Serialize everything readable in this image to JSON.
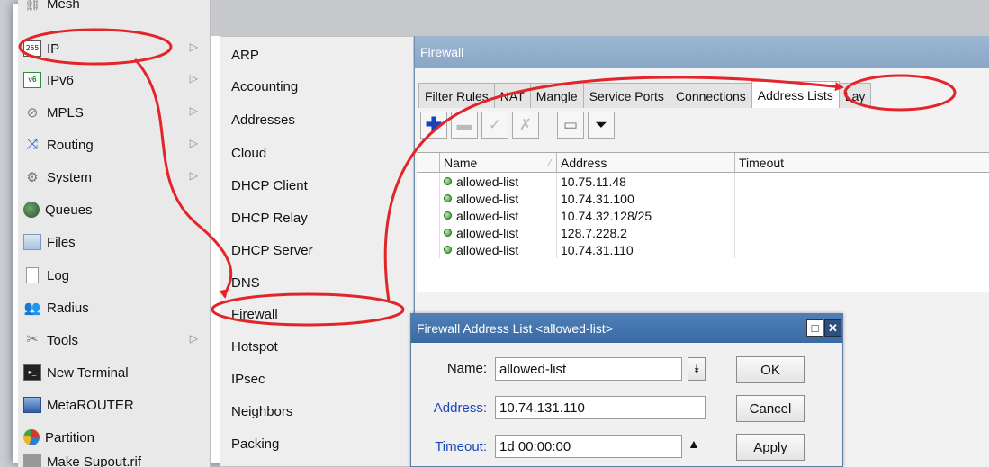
{
  "left_menu": {
    "items": [
      {
        "label": "Mesh",
        "icon": "mesh-icon"
      },
      {
        "label": "IP",
        "icon": "ip-icon",
        "icon_text": "255",
        "has_submenu": true
      },
      {
        "label": "IPv6",
        "icon": "ipv6-icon",
        "icon_text": "v6",
        "has_submenu": true
      },
      {
        "label": "MPLS",
        "icon": "mpls-icon",
        "has_submenu": true
      },
      {
        "label": "Routing",
        "icon": "routing-icon",
        "has_submenu": true
      },
      {
        "label": "System",
        "icon": "system-icon",
        "has_submenu": true
      },
      {
        "label": "Queues",
        "icon": "queues-icon"
      },
      {
        "label": "Files",
        "icon": "files-icon"
      },
      {
        "label": "Log",
        "icon": "log-icon"
      },
      {
        "label": "Radius",
        "icon": "radius-icon"
      },
      {
        "label": "Tools",
        "icon": "tools-icon",
        "has_submenu": true
      },
      {
        "label": "New Terminal",
        "icon": "terminal-icon"
      },
      {
        "label": "MetaROUTER",
        "icon": "metarouter-icon"
      },
      {
        "label": "Partition",
        "icon": "partition-icon"
      },
      {
        "label": "Make Supout.rif",
        "icon": "supout-icon"
      }
    ]
  },
  "ip_submenu": {
    "items": [
      "ARP",
      "Accounting",
      "Addresses",
      "Cloud",
      "DHCP Client",
      "DHCP Relay",
      "DHCP Server",
      "DNS",
      "Firewall",
      "Hotspot",
      "IPsec",
      "Neighbors",
      "Packing"
    ]
  },
  "firewall": {
    "title": "Firewall",
    "tabs": [
      "Filter Rules",
      "NAT",
      "Mangle",
      "Service Ports",
      "Connections",
      "Address Lists",
      "Lay"
    ],
    "active_tab": "Address Lists",
    "columns": [
      "Name",
      "Address",
      "Timeout"
    ],
    "rows": [
      {
        "name": "allowed-list",
        "address": "10.75.11.48",
        "timeout": ""
      },
      {
        "name": "allowed-list",
        "address": "10.74.31.100",
        "timeout": ""
      },
      {
        "name": "allowed-list",
        "address": "10.74.32.128/25",
        "timeout": ""
      },
      {
        "name": "allowed-list",
        "address": "128.7.228.2",
        "timeout": ""
      },
      {
        "name": "allowed-list",
        "address": "10.74.31.110",
        "timeout": ""
      }
    ]
  },
  "dialog": {
    "title": "Firewall Address List <allowed-list>",
    "name_label": "Name:",
    "name_value": "allowed-list",
    "address_label": "Address:",
    "address_value": "10.74.131.110",
    "timeout_label": "Timeout:",
    "timeout_value": "1d 00:00:00",
    "ok_label": "OK",
    "cancel_label": "Cancel",
    "apply_label": "Apply"
  },
  "annotation_color": "#e3252a"
}
